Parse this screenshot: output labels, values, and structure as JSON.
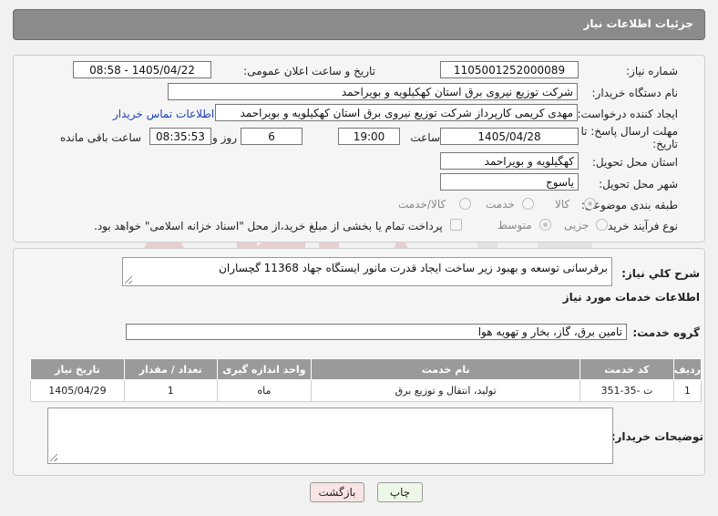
{
  "header": {
    "title": "جزئیات اطلاعات نیاز"
  },
  "form": {
    "need_number_label": "شماره نیاز:",
    "need_number": "1105001252000089",
    "announce_label": "تاریخ و ساعت اعلان عمومی:",
    "announce_value": "1405/04/22 - 08:58",
    "buyer_label": "نام دستگاه خریدار:",
    "buyer_value": "شرکت توزیع نیروی برق استان کهکیلویه و بویراحمد",
    "creator_label": "ایجاد کننده درخواست:",
    "creator_value": "مهدی کریمی کارپرداز شرکت توزیع نیروی برق استان کهکیلویه و بویراحمد",
    "contact_link": "اطلاعات تماس خریدار",
    "deadline_label_1": "مهلت ارسال پاسخ: تا",
    "deadline_label_2": "تاریخ:",
    "deadline_date": "1405/04/28",
    "time_label": "ساعت",
    "deadline_time": "19:00",
    "days_value": "6",
    "days_label": "روز و",
    "remaining_time": "08:35:53",
    "remaining_label": "ساعت باقی مانده",
    "province_label": "استان محل تحویل:",
    "province_value": "کهگیلویه و بویراحمد",
    "city_label": "شهر محل تحویل:",
    "city_value": "یاسوج",
    "category_label": "طبقه بندی موضوعی:",
    "category_options": [
      "کالا",
      "خدمت",
      "کالا/خدمت"
    ],
    "process_label": "نوع فرآیند خرید :",
    "process_options": [
      "جزیی",
      "متوسط"
    ],
    "payment_note": "پرداخت تمام یا بخشی از مبلغ خرید،از محل \"اسناد خزانه اسلامی\" خواهد بود."
  },
  "summary": {
    "label": "شرح کلي نياز:",
    "value": "برقرسانی توسعه و بهبود زیر ساخت ایجاد قدرت مانور ایستگاه جهاد 11368 گچساران"
  },
  "services": {
    "section_title": "اطلاعات خدمات مورد نیاز",
    "group_label": "گروه خدمت:",
    "group_value": "تامین برق، گاز، بخار و تهویه هوا",
    "columns": [
      "ردیف",
      "کد خدمت",
      "نام خدمت",
      "واحد اندازه گیری",
      "تعداد / مقدار",
      "تاریخ نیاز"
    ],
    "rows": [
      [
        "1",
        "ت -35-351",
        "تولید، انتقال و توزیع برق",
        "ماه",
        "1",
        "1405/04/29"
      ]
    ]
  },
  "buyer_notes": {
    "label": "توضیحات خریدار:",
    "value": ""
  },
  "buttons": {
    "print": "چاپ",
    "back": "بازگشت"
  },
  "colors": {
    "header_bg": "#8b8b8b",
    "link": "#1a3fbf",
    "back_button": "#f8e4e4",
    "print_button": "#eef8e8"
  }
}
